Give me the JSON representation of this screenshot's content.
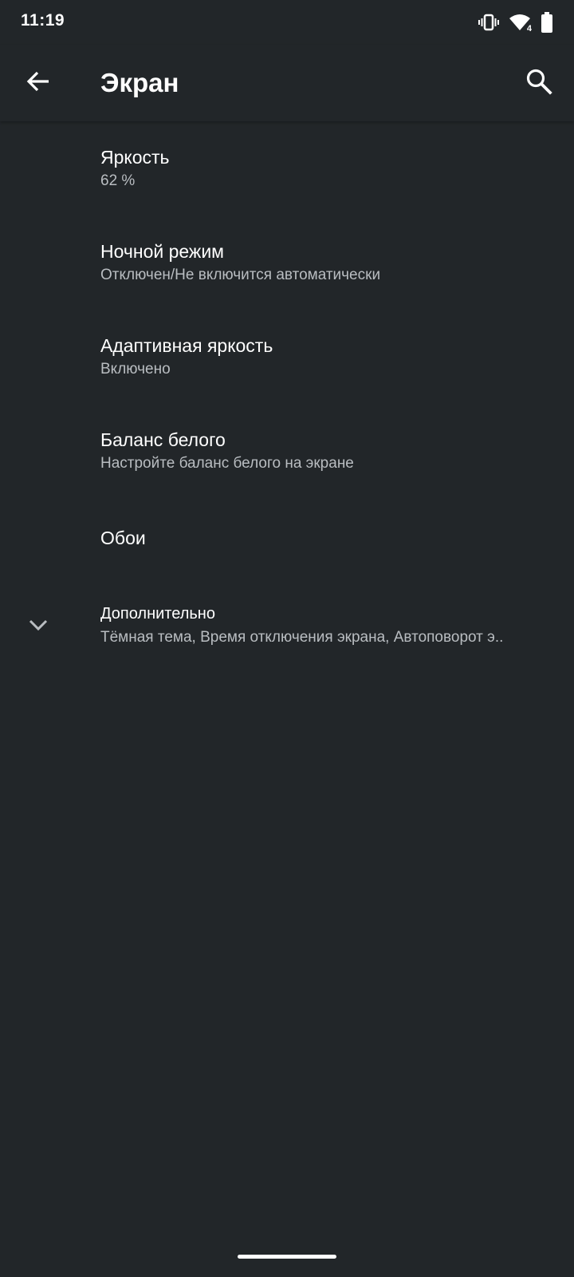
{
  "status_bar": {
    "time": "11:19",
    "signal_badge": "4",
    "icons": [
      "vibrate-icon",
      "wifi-icon",
      "battery-icon"
    ]
  },
  "app_bar": {
    "title": "Экран",
    "back_icon": "arrow-back-icon",
    "search_icon": "search-icon"
  },
  "settings": [
    {
      "title": "Яркость",
      "summary": "62 %"
    },
    {
      "title": "Ночной режим",
      "summary": "Отключен/Не включится автоматически"
    },
    {
      "title": "Адаптивная яркость",
      "summary": "Включено"
    },
    {
      "title": "Баланс белого",
      "summary": "Настройте баланс белого на экране"
    },
    {
      "title": "Обои"
    },
    {
      "title": "Дополнительно",
      "summary": "Тёмная тема, Время отключения экрана, Автоповорот э..",
      "icon": "chevron-down-icon"
    }
  ],
  "colors": {
    "background": "#222629",
    "text_primary": "#ffffff",
    "text_secondary": "#b9bdc1"
  }
}
